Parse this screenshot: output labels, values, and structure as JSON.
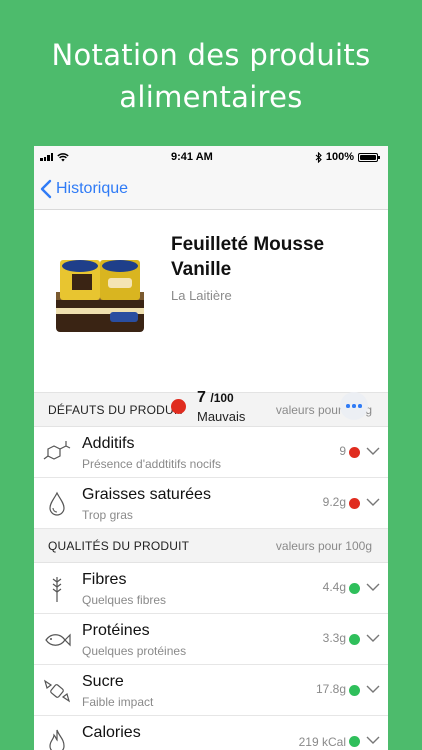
{
  "headline": {
    "line1": "Notation des produits",
    "line2": "alimentaires"
  },
  "statusbar": {
    "time": "9:41 AM",
    "battery": "100%"
  },
  "nav": {
    "back_label": "Historique"
  },
  "product": {
    "title": "Feuilleté Mousse Vanille",
    "brand": "La Laitière",
    "score": "7",
    "score_max": "/100",
    "rating": "Mauvais",
    "score_color": "#e02c1f"
  },
  "defects": {
    "title": "DÉFAUTS DU PRODUIT",
    "note": "valeurs pour 100g",
    "items": [
      {
        "icon": "additives-icon",
        "title": "Additifs",
        "subtitle": "Présence d'addtitifs nocifs",
        "value": "9",
        "status_color": "#e02c1f"
      },
      {
        "icon": "drop-icon",
        "title": "Graisses saturées",
        "subtitle": "Trop gras",
        "value": "9.2g",
        "status_color": "#e02c1f"
      }
    ]
  },
  "qualities": {
    "title": "QUALITÉS DU PRODUIT",
    "note": "valeurs pour 100g",
    "items": [
      {
        "icon": "wheat-icon",
        "title": "Fibres",
        "subtitle": "Quelques fibres",
        "value": "4.4g",
        "status_color": "#2fbf5b"
      },
      {
        "icon": "fish-icon",
        "title": "Protéines",
        "subtitle": "Quelques protéines",
        "value": "3.3g",
        "status_color": "#2fbf5b"
      },
      {
        "icon": "candy-icon",
        "title": "Sucre",
        "subtitle": "Faible impact",
        "value": "17.8g",
        "status_color": "#2fbf5b"
      },
      {
        "icon": "flame-icon",
        "title": "Calories",
        "subtitle": "",
        "value": "219 kCal",
        "status_color": "#2fbf5b"
      }
    ]
  },
  "colors": {
    "background": "#4dbb6c",
    "accent": "#2f7bf6"
  }
}
